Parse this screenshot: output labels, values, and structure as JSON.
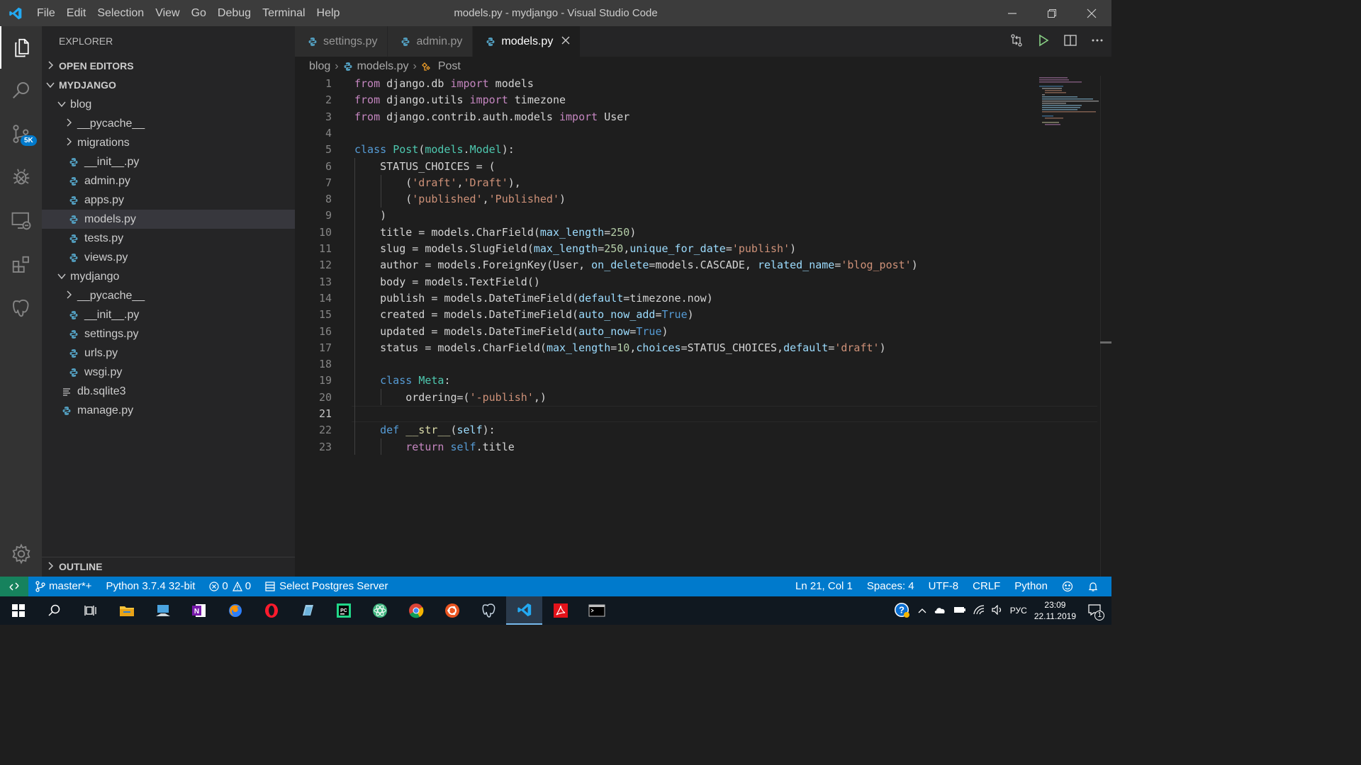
{
  "window": {
    "title": "models.py - mydjango - Visual Studio Code",
    "menu": [
      "File",
      "Edit",
      "Selection",
      "View",
      "Go",
      "Debug",
      "Terminal",
      "Help"
    ]
  },
  "activity": {
    "scm_badge": "5K"
  },
  "sidebar": {
    "header": "EXPLORER",
    "open_editors": "OPEN EDITORS",
    "project": "MYDJANGO",
    "outline": "OUTLINE",
    "tree": [
      {
        "label": "blog",
        "type": "folder-open",
        "depth": 1
      },
      {
        "label": "__pycache__",
        "type": "folder",
        "depth": 2
      },
      {
        "label": "migrations",
        "type": "folder",
        "depth": 2
      },
      {
        "label": "__init__.py",
        "type": "py",
        "depth": 2
      },
      {
        "label": "admin.py",
        "type": "py",
        "depth": 2
      },
      {
        "label": "apps.py",
        "type": "py",
        "depth": 2
      },
      {
        "label": "models.py",
        "type": "py",
        "depth": 2,
        "selected": true
      },
      {
        "label": "tests.py",
        "type": "py",
        "depth": 2
      },
      {
        "label": "views.py",
        "type": "py",
        "depth": 2
      },
      {
        "label": "mydjango",
        "type": "folder-open",
        "depth": 1
      },
      {
        "label": "__pycache__",
        "type": "folder",
        "depth": 2
      },
      {
        "label": "__init__.py",
        "type": "py",
        "depth": 2
      },
      {
        "label": "settings.py",
        "type": "py",
        "depth": 2
      },
      {
        "label": "urls.py",
        "type": "py",
        "depth": 2
      },
      {
        "label": "wsgi.py",
        "type": "py",
        "depth": 2
      },
      {
        "label": "db.sqlite3",
        "type": "db",
        "depth": 1
      },
      {
        "label": "manage.py",
        "type": "py",
        "depth": 1
      }
    ]
  },
  "tabs": [
    {
      "label": "settings.py",
      "active": false
    },
    {
      "label": "admin.py",
      "active": false
    },
    {
      "label": "models.py",
      "active": true
    }
  ],
  "breadcrumb": [
    "blog",
    "models.py",
    "Post"
  ],
  "editor": {
    "current_line": 21,
    "lines": [
      [
        [
          "kw2",
          "from"
        ],
        [
          "txt",
          " django.db "
        ],
        [
          "kw2",
          "import"
        ],
        [
          "txt",
          " models"
        ]
      ],
      [
        [
          "kw2",
          "from"
        ],
        [
          "txt",
          " django.utils "
        ],
        [
          "kw2",
          "import"
        ],
        [
          "txt",
          " timezone"
        ]
      ],
      [
        [
          "kw2",
          "from"
        ],
        [
          "txt",
          " django.contrib.auth.models "
        ],
        [
          "kw2",
          "import"
        ],
        [
          "txt",
          " User"
        ]
      ],
      [],
      [
        [
          "kw",
          "class"
        ],
        [
          "txt",
          " "
        ],
        [
          "cls",
          "Post"
        ],
        [
          "txt",
          "("
        ],
        [
          "cls",
          "models"
        ],
        [
          "txt",
          "."
        ],
        [
          "cls",
          "Model"
        ],
        [
          "txt",
          "):"
        ]
      ],
      [
        [
          "txt",
          "    STATUS_CHOICES = ("
        ]
      ],
      [
        [
          "txt",
          "        ("
        ],
        [
          "str",
          "'draft'"
        ],
        [
          "txt",
          ","
        ],
        [
          "str",
          "'Draft'"
        ],
        [
          "txt",
          "),"
        ]
      ],
      [
        [
          "txt",
          "        ("
        ],
        [
          "str",
          "'published'"
        ],
        [
          "txt",
          ","
        ],
        [
          "str",
          "'Published'"
        ],
        [
          "txt",
          ")"
        ]
      ],
      [
        [
          "txt",
          "    )"
        ]
      ],
      [
        [
          "txt",
          "    title = models.CharField("
        ],
        [
          "prm",
          "max_length"
        ],
        [
          "txt",
          "="
        ],
        [
          "num",
          "250"
        ],
        [
          "txt",
          ")"
        ]
      ],
      [
        [
          "txt",
          "    slug = models.SlugField("
        ],
        [
          "prm",
          "max_length"
        ],
        [
          "txt",
          "="
        ],
        [
          "num",
          "250"
        ],
        [
          "txt",
          ","
        ],
        [
          "prm",
          "unique_for_date"
        ],
        [
          "txt",
          "="
        ],
        [
          "str",
          "'publish'"
        ],
        [
          "txt",
          ")"
        ]
      ],
      [
        [
          "txt",
          "    author = models.ForeignKey(User, "
        ],
        [
          "prm",
          "on_delete"
        ],
        [
          "txt",
          "=models.CASCADE, "
        ],
        [
          "prm",
          "related_name"
        ],
        [
          "txt",
          "="
        ],
        [
          "str",
          "'blog_post'"
        ],
        [
          "txt",
          ")"
        ]
      ],
      [
        [
          "txt",
          "    body = models.TextField()"
        ]
      ],
      [
        [
          "txt",
          "    publish = models.DateTimeField("
        ],
        [
          "prm",
          "default"
        ],
        [
          "txt",
          "=timezone.now)"
        ]
      ],
      [
        [
          "txt",
          "    created = models.DateTimeField("
        ],
        [
          "prm",
          "auto_now_add"
        ],
        [
          "txt",
          "="
        ],
        [
          "kw",
          "True"
        ],
        [
          "txt",
          ")"
        ]
      ],
      [
        [
          "txt",
          "    updated = models.DateTimeField("
        ],
        [
          "prm",
          "auto_now"
        ],
        [
          "txt",
          "="
        ],
        [
          "kw",
          "True"
        ],
        [
          "txt",
          ")"
        ]
      ],
      [
        [
          "txt",
          "    status = models.CharField("
        ],
        [
          "prm",
          "max_length"
        ],
        [
          "txt",
          "="
        ],
        [
          "num",
          "10"
        ],
        [
          "txt",
          ","
        ],
        [
          "prm",
          "choices"
        ],
        [
          "txt",
          "=STATUS_CHOICES,"
        ],
        [
          "prm",
          "default"
        ],
        [
          "txt",
          "="
        ],
        [
          "str",
          "'draft'"
        ],
        [
          "txt",
          ")"
        ]
      ],
      [],
      [
        [
          "txt",
          "    "
        ],
        [
          "kw",
          "class"
        ],
        [
          "txt",
          " "
        ],
        [
          "cls",
          "Meta"
        ],
        [
          "txt",
          ":"
        ]
      ],
      [
        [
          "txt",
          "        ordering=("
        ],
        [
          "str",
          "'-publish'"
        ],
        [
          "txt",
          ",)"
        ]
      ],
      [],
      [
        [
          "txt",
          "    "
        ],
        [
          "kw",
          "def"
        ],
        [
          "txt",
          " "
        ],
        [
          "fn",
          "__str__"
        ],
        [
          "txt",
          "("
        ],
        [
          "prm",
          "self"
        ],
        [
          "txt",
          "):"
        ]
      ],
      [
        [
          "txt",
          "        "
        ],
        [
          "kw2",
          "return"
        ],
        [
          "txt",
          " "
        ],
        [
          "kw",
          "self"
        ],
        [
          "txt",
          ".title"
        ]
      ]
    ]
  },
  "statusbar": {
    "branch": "master*+",
    "python": "Python 3.7.4 32-bit",
    "errors": "0",
    "warnings": "0",
    "postgres": "Select Postgres Server",
    "position": "Ln 21, Col 1",
    "spaces": "Spaces: 4",
    "encoding": "UTF-8",
    "eol": "CRLF",
    "language": "Python"
  },
  "taskbar": {
    "apps": [
      "windows-start",
      "search",
      "task-view",
      "file-explorer",
      "connect",
      "onenote",
      "firefox",
      "opera",
      "notepad",
      "pycharm",
      "atom",
      "chrome",
      "ubuntu",
      "pgadmin",
      "vscode",
      "acrobat",
      "terminal"
    ],
    "active_app": "vscode",
    "lang": "РУС",
    "time": "23:09",
    "date": "22.11.2019",
    "notifications": "1"
  },
  "colors": {
    "accent": "#007acc",
    "remote": "#16825d",
    "titlebar": "#3c3c3c",
    "sidebar": "#252526",
    "editor": "#1e1e1e"
  }
}
